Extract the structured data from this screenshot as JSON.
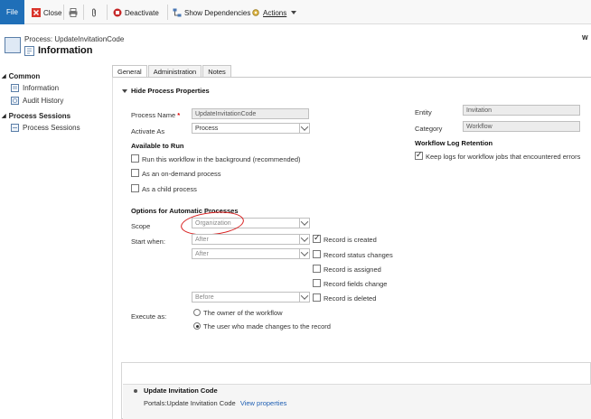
{
  "ribbon": {
    "file": "File",
    "close": "Close",
    "deactivate": "Deactivate",
    "show_dependencies": "Show Dependencies",
    "actions": "Actions"
  },
  "header": {
    "process_label": "Process: UpdateInvitationCode",
    "title": "Information",
    "corner": "W"
  },
  "nav": {
    "common": "Common",
    "information": "Information",
    "audit_history": "Audit History",
    "process_sessions_header": "Process Sessions",
    "process_sessions": "Process Sessions"
  },
  "tabs": [
    "General",
    "Administration",
    "Notes"
  ],
  "section": {
    "hide_props": "Hide Process Properties"
  },
  "form": {
    "process_name_label": "Process Name",
    "process_name_value": "UpdateInvitationCode",
    "activate_as_label": "Activate As",
    "activate_as_value": "Process",
    "available_to_run": "Available to Run",
    "opt_background": "Run this workflow in the background (recommended)",
    "opt_on_demand": "As an on-demand process",
    "opt_child": "As a child process",
    "entity_label": "Entity",
    "entity_value": "Invitation",
    "category_label": "Category",
    "category_value": "Workflow",
    "log_retention": "Workflow Log Retention",
    "keep_logs": "Keep logs for workflow jobs that encountered errors",
    "options_auto": "Options for Automatic Processes",
    "scope_label": "Scope",
    "scope_value": "Organization",
    "start_when_label": "Start when:",
    "after1": "After",
    "after2": "After",
    "before": "Before",
    "record_created": "Record is created",
    "record_status": "Record status changes",
    "record_assigned": "Record is assigned",
    "record_fields": "Record fields change",
    "record_deleted": "Record is deleted",
    "execute_as_label": "Execute as:",
    "owner_opt": "The owner of the workflow",
    "user_opt": "The user who made changes to the record"
  },
  "step": {
    "title": "Update Invitation Code",
    "desc": "Portals:Update Invitation Code",
    "view_props": "View properties"
  },
  "colors": {
    "accent": "#1f6fb8",
    "annotation": "#d81e1e"
  }
}
